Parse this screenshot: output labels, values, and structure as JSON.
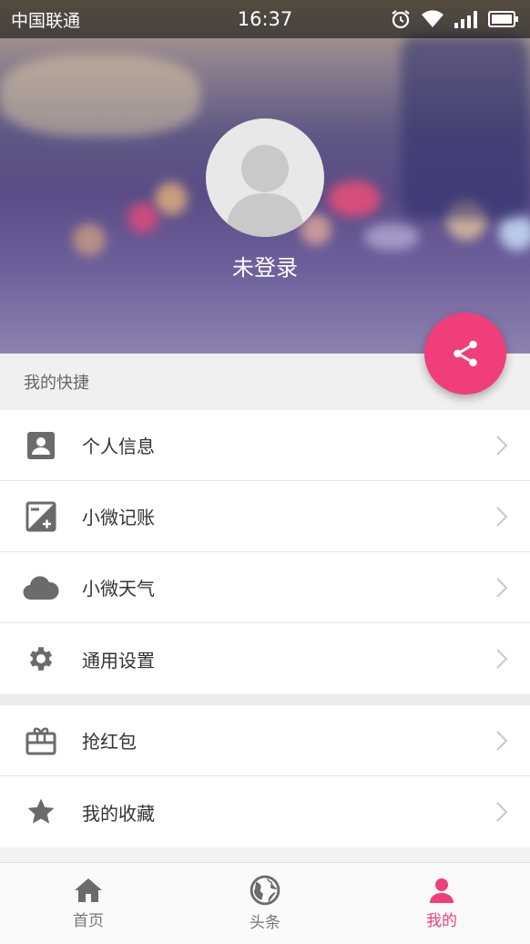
{
  "status_bar": {
    "carrier": "中国联通",
    "time": "16:37"
  },
  "profile": {
    "login_status": "未登录"
  },
  "quick_section": {
    "label": "我的快捷"
  },
  "menu": [
    {
      "label": "个人信息",
      "icon": "person-card-icon"
    },
    {
      "label": "小微记账",
      "icon": "plus-minus-icon"
    },
    {
      "label": "小微天气",
      "icon": "cloud-icon"
    },
    {
      "label": "通用设置",
      "icon": "gear-icon"
    }
  ],
  "menu2": [
    {
      "label": "抢红包",
      "icon": "gift-card-icon"
    },
    {
      "label": "我的收藏",
      "icon": "star-icon"
    }
  ],
  "tabs": [
    {
      "label": "首页",
      "icon": "home-icon",
      "active": false
    },
    {
      "label": "头条",
      "icon": "globe-icon",
      "active": false
    },
    {
      "label": "我的",
      "icon": "person-icon",
      "active": true
    }
  ],
  "colors": {
    "accent": "#f03e7a",
    "icon_gray": "#6b6b6b"
  }
}
